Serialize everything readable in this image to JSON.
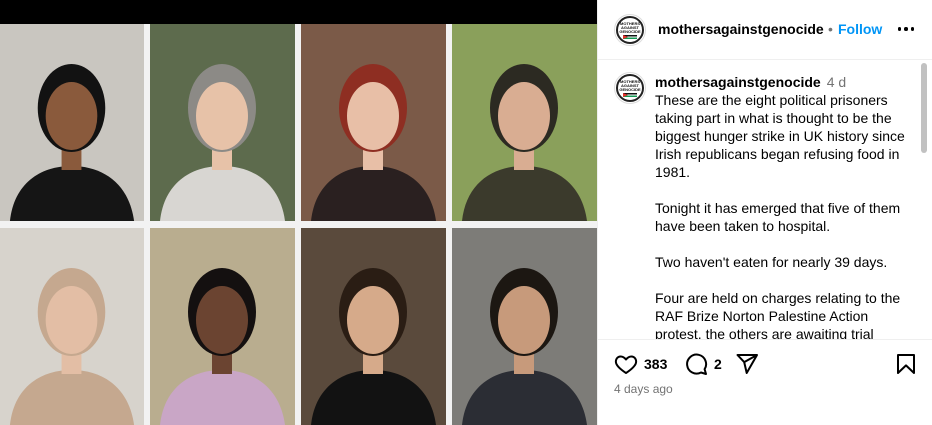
{
  "post": {
    "username": "mothersagainstgenocide",
    "separator": "•",
    "follow_label": "Follow",
    "avatar_text": [
      "MOTHERS",
      "AGAINST",
      "GENOCIDE"
    ]
  },
  "caption": {
    "username": "mothersagainstgenocide",
    "time": "4 d",
    "paragraphs": [
      "These are the eight political prisoners taking part in what is thought to be the biggest hunger strike in UK history since Irish republicans began refusing food in 1981.",
      "Tonight it has emerged that five of them have been taken to hospital.",
      "Two haven't eaten for nearly 39 days.",
      "Four are held on charges relating to the RAF Brize Norton Palestine Action protest, the others are awaiting trial"
    ]
  },
  "actions": {
    "like_count": "383",
    "comment_count": "2",
    "timestamp": "4 days ago"
  },
  "colors": {
    "accent": "#0095f6",
    "muted": "#737373",
    "divider": "#efefef"
  },
  "media": {
    "tiles": [
      {
        "name": "photo-tile-1",
        "bg": "#c9c6c0",
        "skin": "#8a5a3c",
        "hair": "#121212",
        "shirt": "#151515"
      },
      {
        "name": "photo-tile-2",
        "bg": "#5d6b4d",
        "skin": "#e7c2a8",
        "hair": "#8c8a86",
        "shirt": "#d8d6d2"
      },
      {
        "name": "photo-tile-3",
        "bg": "#7b5a48",
        "skin": "#e8bfa7",
        "hair": "#8e2e22",
        "shirt": "#2a2020"
      },
      {
        "name": "photo-tile-4",
        "bg": "#8aa05b",
        "skin": "#d9ad92",
        "hair": "#2c2a22",
        "shirt": "#3b3a2c"
      },
      {
        "name": "photo-tile-5",
        "bg": "#d7d3cc",
        "skin": "#e3bea5",
        "hair": "#c5a88f",
        "shirt": "#c5a88f"
      },
      {
        "name": "photo-tile-6",
        "bg": "#b9ad8f",
        "skin": "#6b4431",
        "hair": "#141010",
        "shirt": "#c9a6c6"
      },
      {
        "name": "photo-tile-7",
        "bg": "#5a4a3c",
        "skin": "#d6aa8a",
        "hair": "#2a1d14",
        "shirt": "#121212"
      },
      {
        "name": "photo-tile-8",
        "bg": "#7d7c78",
        "skin": "#c79a7b",
        "hair": "#1c1712",
        "shirt": "#2b2d34"
      }
    ]
  }
}
